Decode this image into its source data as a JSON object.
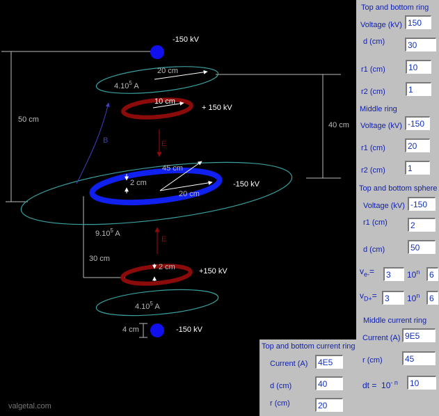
{
  "diagram": {
    "top_sphere_voltage": "-150 kV",
    "bottom_sphere_voltage": "-150 kV",
    "top_ring_voltage": "+ 150 kV",
    "bottom_ring_voltage": "+150 kV",
    "middle_ring_voltage": "-150 kV",
    "dim_50cm": "50 cm",
    "dim_40cm": "40 cm",
    "dim_30cm": "30 cm",
    "dim_20cm_top": "20 cm",
    "dim_10cm": "10 cm",
    "dim_45cm": "45 cm",
    "dim_20cm_mid": "20 cm",
    "dim_2cm_mid": "2 cm",
    "dim_2cm_bottom": "2 cm",
    "dim_4cm": "4 cm",
    "current_top": "4.10",
    "current_mid": "9.10",
    "current_bottom": "4.10",
    "exp": "5",
    "unit_A": "A",
    "label_B": "B",
    "label_E": "E",
    "colors": {
      "sphere": "#1010ee",
      "ring_pos": "#8b0a0a",
      "ring_neg": "#1020ee",
      "current_loop": "#3aa0a0",
      "field_B": "#4040c0"
    }
  },
  "panel": {
    "top_bottom_ring": {
      "title": "Top and bottom ring",
      "voltage_label": "Voltage (kV)",
      "voltage": "150",
      "d_label": "d (cm)",
      "d": "30",
      "r1_label": "r1 (cm)",
      "r1": "10",
      "r2_label": "r2 (cm)",
      "r2": "1"
    },
    "middle_ring": {
      "title": "Middle ring",
      "voltage_label": "Voltage (kV)",
      "voltage": "-150",
      "r1_label": "r1 (cm)",
      "r1": "20",
      "r2_label": "r2 (cm)",
      "r2": "1"
    },
    "top_bottom_sphere": {
      "title": "Top and bottom sphere",
      "voltage_label": "Voltage (kV)",
      "voltage": "-150",
      "r1_label": "r1 (cm)",
      "r1": "2",
      "d_label": "d (cm)",
      "d": "50"
    },
    "velocity": {
      "ve_label": "v",
      "ve_sub": "e-",
      "ve_eq": "=",
      "ve_val": "3",
      "ve_exp": "6",
      "vd_label": "v",
      "vd_sub": "D+",
      "vd_eq": "=",
      "vd_val": "3",
      "vd_exp": "6",
      "ten": "10",
      "n": "n"
    },
    "middle_current_ring": {
      "title": "Middle current ring",
      "current_label": "Current (A)",
      "current": "9E5",
      "r_label": "r  (cm)",
      "r": "45",
      "dt_label": "dt =",
      "dt_ten": "10",
      "dt_exp_label": "- n",
      "dt": "10"
    },
    "top_bottom_current_ring": {
      "title": "Top and bottom current ring",
      "current_label": "Current (A)",
      "current": "4E5",
      "d_label": "d (cm)",
      "d": "40",
      "r_label": "r (cm)",
      "r": "20"
    }
  },
  "footer": "valgetal.com"
}
